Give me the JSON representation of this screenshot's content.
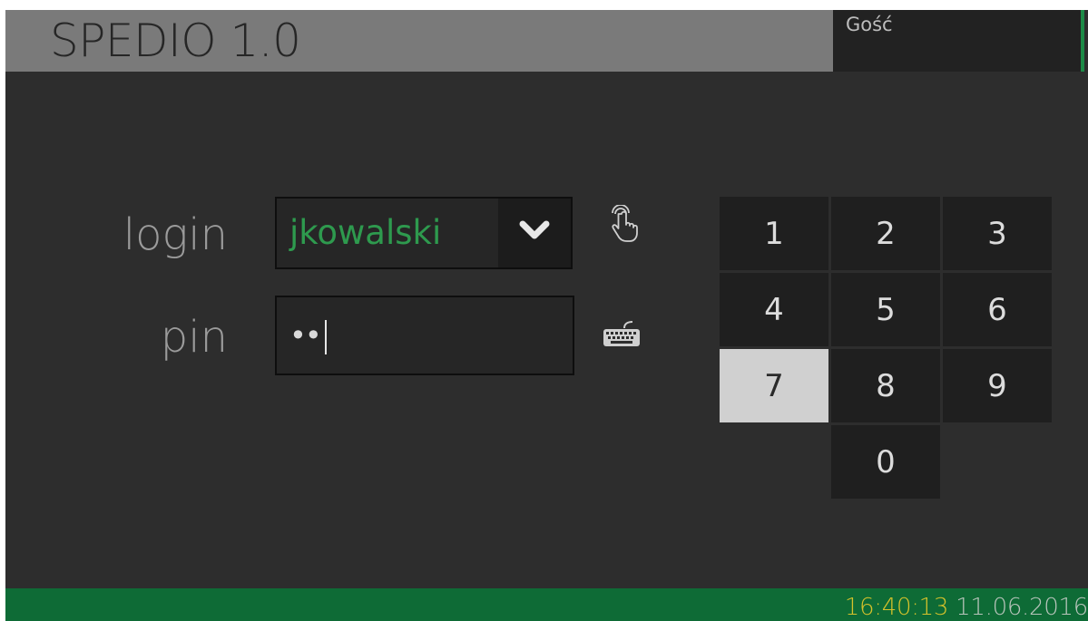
{
  "app": {
    "title": "SPEDIO 1.0"
  },
  "user": {
    "name": "Gość"
  },
  "form": {
    "login_label": "login",
    "login_value": "jkowalski",
    "pin_label": "pin",
    "pin_masked": "••"
  },
  "keypad": {
    "keys": [
      "1",
      "2",
      "3",
      "4",
      "5",
      "6",
      "7",
      "8",
      "9",
      "0"
    ],
    "pressed_key": "7"
  },
  "footer": {
    "time": "16:40:13",
    "date": "11.06.2016"
  },
  "icons": {
    "dropdown": "chevron-down-icon",
    "touch": "touch-hand-icon",
    "keyboard": "keyboard-icon"
  },
  "colors": {
    "accent_green": "#0e6b36",
    "login_text_green": "#2e9a4e",
    "time_yellow": "#d5c22b",
    "date_gray": "#b8c4bb",
    "user_accent": "#1d8a47"
  }
}
